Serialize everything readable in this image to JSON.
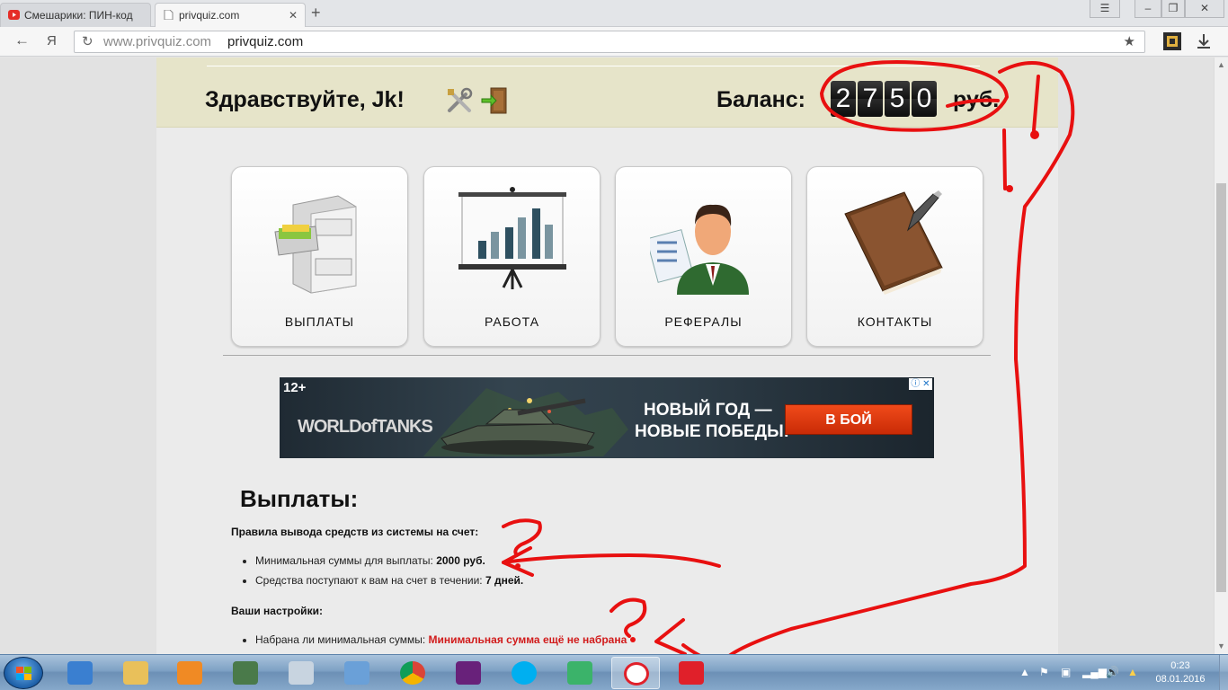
{
  "browser": {
    "tabs": [
      {
        "title": "Смешарики: ПИН-код",
        "icon": "youtube-icon"
      },
      {
        "title": "privquiz.com",
        "icon": "page-icon"
      }
    ],
    "new_tab": "+",
    "address": {
      "host": "www.privquiz.com",
      "query": "privquiz.com"
    },
    "nav": {
      "back": "←",
      "yandex": "Я"
    }
  },
  "header": {
    "greeting": "Здравствуйте, Jk!",
    "balance_label": "Баланс:",
    "balance_digits": [
      "2",
      "7",
      "5",
      "0"
    ],
    "currency": "руб."
  },
  "menu": [
    {
      "label": "ВЫПЛАТЫ",
      "icon": "file-cabinet-icon"
    },
    {
      "label": "РАБОТА",
      "icon": "presentation-chart-icon"
    },
    {
      "label": "РЕФЕРАЛЫ",
      "icon": "businessman-icon"
    },
    {
      "label": "КОНТАКТЫ",
      "icon": "notebook-pen-icon"
    }
  ],
  "banner": {
    "age": "12+",
    "brand": "WORLDofTANKS",
    "slogan_line1": "НОВЫЙ ГОД —",
    "slogan_line2": "НОВЫЕ ПОБЕДЫ!",
    "cta": "В БОЙ",
    "ad_info": "ⓘ ✕"
  },
  "payouts": {
    "heading": "Выплаты:",
    "rules_title": "Правила вывода средств из системы на счет:",
    "rules": [
      {
        "text": "Минимальная суммы для выплаты: ",
        "value": "2000 руб."
      },
      {
        "text": "Средства поступают к вам на счет в течении: ",
        "value": "7 дней."
      }
    ],
    "settings_title": "Ваши настройки:",
    "settings": [
      {
        "text": "Набрана ли минимальная суммы: ",
        "value": "Минимальная сумма ещё не набрана"
      }
    ]
  },
  "taskbar": {
    "items": [
      "speaker-app-icon",
      "explorer-icon",
      "media-player-icon",
      "task-manager-icon",
      "calculator-icon",
      "control-panel-icon",
      "chrome-icon",
      "visual-studio-icon",
      "skype-icon",
      "cubes-icon",
      "yandex-browser-icon",
      "yandex-icon"
    ],
    "clock_time": "0:23",
    "clock_date": "08.01.2016"
  },
  "colors": {
    "accent_red": "#e01010",
    "header_band": "#e6e4c9",
    "cta": "#e03c12"
  }
}
